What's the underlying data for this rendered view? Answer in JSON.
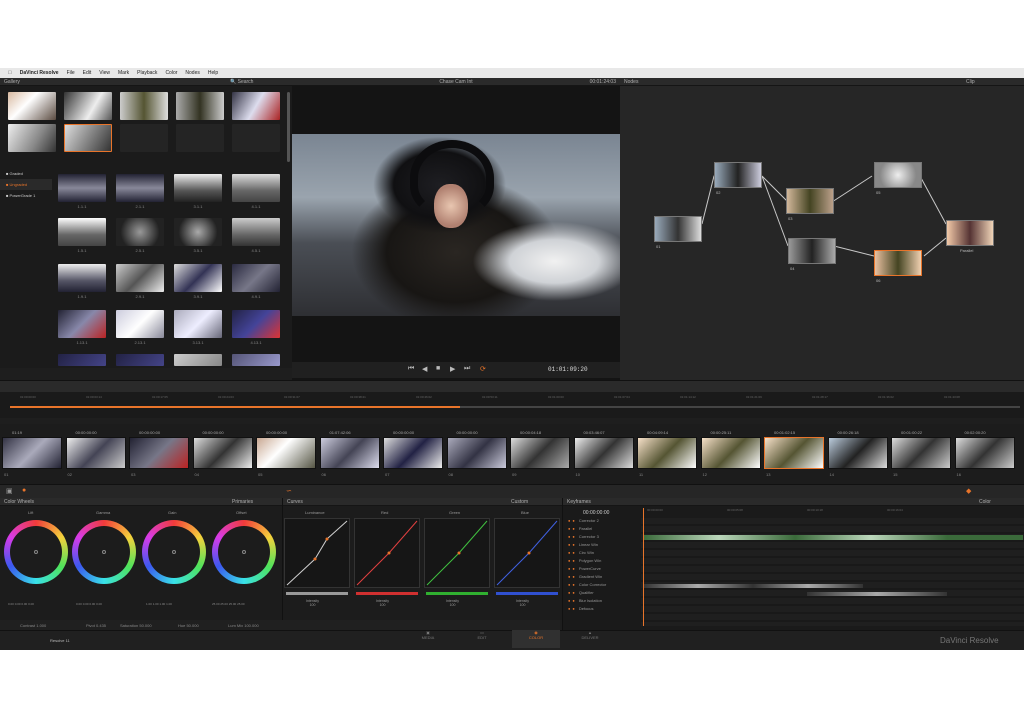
{
  "menubar": {
    "app_name": "DaVinci Resolve",
    "items": [
      "File",
      "Edit",
      "View",
      "Mark",
      "Playback",
      "Color",
      "Nodes",
      "Help"
    ]
  },
  "gallery": {
    "title": "Gallery",
    "search_placeholder": "Search",
    "albums": [
      "Graded",
      "Ungraded",
      "PowerGrade 1"
    ],
    "still_labels": [
      "1.1.1",
      "2.1.1",
      "3.1.1",
      "4.1.1",
      "1.5.1",
      "2.5.1",
      "3.5.1",
      "4.5.1",
      "1.9.1",
      "2.9.1",
      "3.9.1",
      "4.9.1",
      "1.13.1",
      "2.13.1",
      "3.13.1",
      "4.13.1"
    ]
  },
  "viewer": {
    "clip_name": "Chase Cam Int",
    "timecode_top": "00:01:24:03",
    "timecode": "01:01:09:20"
  },
  "nodes": {
    "title": "Nodes",
    "mode": "Clip",
    "labels": [
      "01",
      "02",
      "03",
      "04",
      "05",
      "06",
      "Parallel"
    ]
  },
  "timeline_ruler": [
    "01:00:00:00",
    "01:00:03:14",
    "01:00:17:05",
    "01:00:24:03",
    "01:00:31:07",
    "01:00:38:21",
    "01:00:46:02",
    "01:00:53:11",
    "01:01:00:00",
    "01:01:07:04",
    "01:01:14:12",
    "01:01:21:09",
    "01:01:28:17",
    "01:01:36:02",
    "01:01:43:08"
  ],
  "clips": {
    "timecodes": [
      "01:19",
      "00:00:00:00",
      "00:00:00:00",
      "00:00:00:00",
      "00:00:00:00",
      "01:07:42:06",
      "00:00:00:00",
      "00:00:00:00",
      "00:00:04:18",
      "00:03:46:07",
      "00:04:09:14",
      "00:00:25:11",
      "00:01:02:15",
      "00:00:26:18",
      "00:01:00:22",
      "00:02:00:20"
    ],
    "labels": [
      "01",
      "02",
      "03",
      "04",
      "05",
      "06",
      "07",
      "08",
      "09",
      "10",
      "11",
      "12",
      "13",
      "14",
      "15",
      "16"
    ]
  },
  "color_wheels": {
    "title": "Color Wheels",
    "mode": "Primaries",
    "wheels": [
      "Lift",
      "Gamma",
      "Gain",
      "Offset"
    ],
    "values": [
      [
        "0.00",
        "0.00",
        "0.00",
        "0.00"
      ],
      [
        "0.00",
        "0.00",
        "0.00",
        "0.00"
      ],
      [
        "1.00",
        "1.00",
        "1.00",
        "1.00"
      ],
      [
        "25.00",
        "25.00",
        "25.00",
        "25.00"
      ]
    ],
    "footer": {
      "contrast": "Contrast 1.000",
      "pivot": "Pivot 0.435",
      "saturation": "Saturation 50.000",
      "hue": "Hue 50.000",
      "lummix": "Lum Mix 100.000"
    }
  },
  "curves": {
    "title": "Curves",
    "mode": "Custom",
    "channels": [
      "Luminance",
      "Red",
      "Green",
      "Blue"
    ],
    "intensity_label": "Intensity",
    "intensity_value": "100"
  },
  "keyframes": {
    "title": "Keyframes",
    "mode": "Color",
    "timecode": "00:00:00:00",
    "ruler": [
      "00:00:00:00",
      "00:00:05:08",
      "00:00:10:18",
      "00:00:16:04"
    ],
    "rows": [
      "Corrector 2",
      "Parallel",
      "Corrector 3",
      "Linear Win",
      "Circ Win",
      "Polygon Win",
      "PowerCurve",
      "Gradient Win",
      "Color Corrector",
      "Qualifier",
      "Blur Isolation",
      "Defocus"
    ]
  },
  "pages": {
    "items": [
      "MEDIA",
      "EDIT",
      "COLOR",
      "DELIVER"
    ],
    "active": "COLOR"
  },
  "project_name": "Resolve 11",
  "brand": "DaVinci Resolve",
  "colors": {
    "accent": "#e8742a",
    "node_line": "#c8c8c8",
    "panel": "#1e1e1e"
  }
}
